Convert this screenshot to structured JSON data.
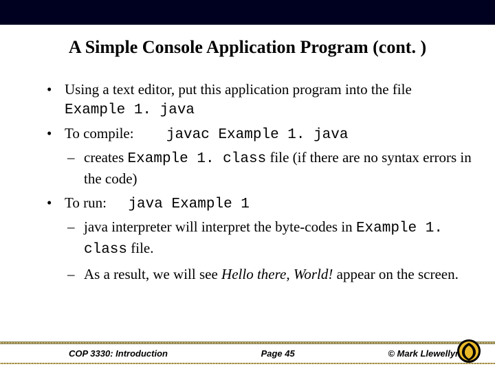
{
  "title": "A Simple Console Application Program (cont. )",
  "bullets": {
    "b1_pre": "Using a text editor, put this application program into the file ",
    "b1_code": "Example 1. java",
    "b2_pre": "To compile:",
    "b2_code": "javac Example 1. java",
    "b2_sub1_pre": "creates ",
    "b2_sub1_code": "Example 1. class",
    "b2_sub1_post": " file (if there are no syntax errors in the code)",
    "b3_pre": "To run:",
    "b3_code": "java Example 1",
    "b3_sub1_pre": "java interpreter will interpret the byte-codes in ",
    "b3_sub1_code": "Example 1. class",
    "b3_sub1_post": " file.",
    "b3_sub2_pre": "As a result, we will see  ",
    "b3_sub2_em": "Hello there, World!",
    "b3_sub2_post": "  appear on the screen."
  },
  "footer": {
    "course": "COP 3330:  Introduction",
    "page": "Page 45",
    "copyright": "© Mark Llewellyn"
  }
}
